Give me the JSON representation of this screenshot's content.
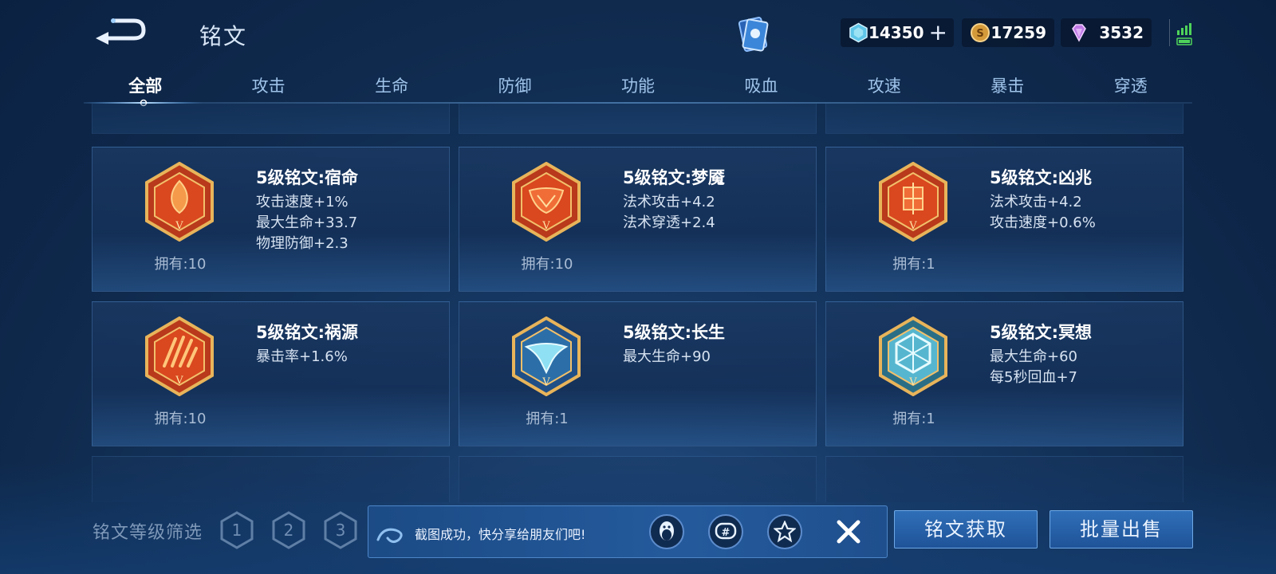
{
  "header": {
    "title": "铭文",
    "back_icon": "back-arrow-icon",
    "resources": [
      {
        "icon": "diamond-crystal-icon",
        "value": "14350",
        "has_plus": true
      },
      {
        "icon": "gold-coin-icon",
        "value": "17259"
      },
      {
        "icon": "gem-icon",
        "value": "3532"
      }
    ]
  },
  "tabs": [
    {
      "label": "全部",
      "active": true
    },
    {
      "label": "攻击"
    },
    {
      "label": "生命"
    },
    {
      "label": "防御"
    },
    {
      "label": "功能"
    },
    {
      "label": "吸血"
    },
    {
      "label": "攻速"
    },
    {
      "label": "暴击"
    },
    {
      "label": "穿透"
    }
  ],
  "runes": [
    {
      "name": "5级铭文:宿命",
      "stats": [
        "攻击速度+1%",
        "最大生命+33.7",
        "物理防御+2.3"
      ],
      "owned": "拥有:10",
      "color": "red"
    },
    {
      "name": "5级铭文:梦魇",
      "stats": [
        "法术攻击+4.2",
        "法术穿透+2.4"
      ],
      "owned": "拥有:10",
      "color": "red"
    },
    {
      "name": "5级铭文:凶兆",
      "stats": [
        "法术攻击+4.2",
        "攻击速度+0.6%"
      ],
      "owned": "拥有:1",
      "color": "red"
    },
    {
      "name": "5级铭文:祸源",
      "stats": [
        "暴击率+1.6%"
      ],
      "owned": "拥有:10",
      "color": "red"
    },
    {
      "name": "5级铭文:长生",
      "stats": [
        "最大生命+90"
      ],
      "owned": "拥有:1",
      "color": "blue"
    },
    {
      "name": "5级铭文:冥想",
      "stats": [
        "最大生命+60",
        "每5秒回血+7"
      ],
      "owned": "拥有:1",
      "color": "blue"
    }
  ],
  "footer": {
    "filter_label": "铭文等级筛选",
    "levels": [
      "1",
      "2",
      "3"
    ],
    "toast_text": "截图成功，快分享给朋友们吧!",
    "share_icons": [
      "qq-penguin-icon",
      "wechat-icon",
      "qzone-star-icon"
    ],
    "close_icon": "close-icon",
    "get_button": "铭文获取",
    "sell_button": "批量出售"
  },
  "colors": {
    "accent": "#2f6fb8",
    "rune_red": "#c8331c",
    "rune_blue": "#2c6fa8",
    "gold": "#e0a94a"
  }
}
